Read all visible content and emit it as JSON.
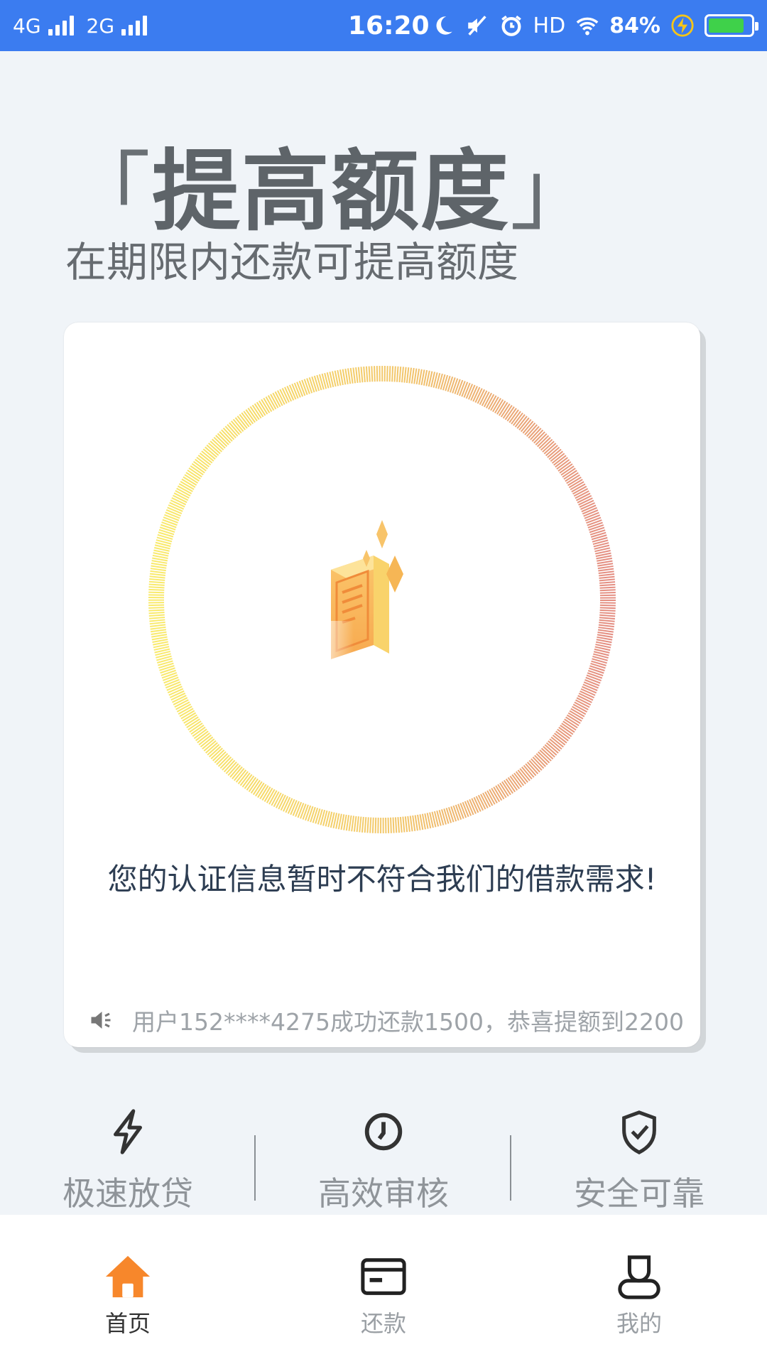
{
  "status_bar": {
    "net1": "4G",
    "net2": "2G",
    "time": "16:20",
    "hd": "HD",
    "battery": "84%",
    "battery_level": 0.84,
    "icons": [
      "moon-icon",
      "mute-icon",
      "alarm-icon",
      "wifi-icon",
      "charging-icon",
      "battery-icon"
    ]
  },
  "header": {
    "bracket_open": "「",
    "title": "提高额度",
    "bracket_close": "」",
    "subtitle": "在期限内还款可提高额度"
  },
  "card": {
    "message": "您的认证信息暂时不符合我们的借款需求!",
    "notice": "用户152****4275成功还款1500，恭喜提额到2200",
    "ring_colors": [
      "#f8e86a",
      "#f0c060",
      "#e8908a"
    ]
  },
  "features": [
    {
      "label": "极速放贷",
      "icon": "lightning-icon"
    },
    {
      "label": "高效审核",
      "icon": "clock-icon"
    },
    {
      "label": "安全可靠",
      "icon": "shield-check-icon"
    }
  ],
  "nav": {
    "items": [
      {
        "label": "首页",
        "icon": "home-icon",
        "active": true
      },
      {
        "label": "还款",
        "icon": "card-icon",
        "active": false
      },
      {
        "label": "我的",
        "icon": "user-icon",
        "active": false
      }
    ],
    "active_color": "#f7872b"
  }
}
